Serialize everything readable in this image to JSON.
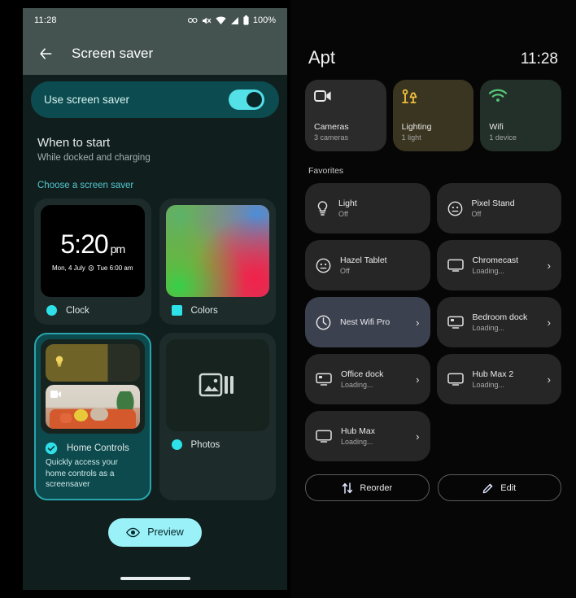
{
  "left": {
    "status_bar": {
      "time": "11:28",
      "battery": "100%",
      "icons": [
        "link-icon",
        "mute-icon",
        "wifi-icon",
        "signal-icon",
        "battery-icon"
      ]
    },
    "appbar": {
      "back_icon": "back-arrow-icon",
      "title": "Screen saver"
    },
    "toggle": {
      "label": "Use screen saver",
      "state": "on"
    },
    "when": {
      "title": "When to start",
      "subtitle": "While docked and charging"
    },
    "choose_label": "Choose a screen saver",
    "cards": [
      {
        "name": "Clock",
        "selected": false,
        "icon": "circle-dot-icon",
        "clock": {
          "time": "5:20",
          "meridiem": "pm",
          "date": "Mon, 4 July",
          "alarm": "Tue 6:00 am",
          "alarm_icon": "alarm-icon"
        }
      },
      {
        "name": "Colors",
        "selected": false,
        "icon": "square-dot-icon"
      },
      {
        "name": "Home Controls",
        "selected": true,
        "icon": "check-circle-icon",
        "description": "Quickly access your home controls as a screensaver",
        "preview_icons": [
          "bulb-icon",
          "camera-icon"
        ]
      },
      {
        "name": "Photos",
        "selected": false,
        "icon": "circle-dot-icon",
        "preview_icon": "photo-stack-icon"
      }
    ],
    "preview_button": {
      "label": "Preview",
      "icon": "eye-icon"
    }
  },
  "right": {
    "title": "Apt",
    "time": "11:28",
    "categories": [
      {
        "name": "Cameras",
        "sub": "3 cameras",
        "icon": "video-camera-icon",
        "bg": "#2b2b2b",
        "fg": "#e9e9e9"
      },
      {
        "name": "Lighting",
        "sub": "1 light",
        "icon": "lamp-icon",
        "bg": "#3a3520",
        "fg": "#f2c23e"
      },
      {
        "name": "Wifi",
        "sub": "1 device",
        "icon": "wifi-icon",
        "bg": "#23302a",
        "fg": "#57c878"
      }
    ],
    "favorites_label": "Favorites",
    "devices": [
      {
        "name": "Light",
        "status": "Off",
        "icon": "bulb-icon",
        "chevron": false,
        "highlight": false
      },
      {
        "name": "Pixel Stand",
        "status": "Off",
        "icon": "face-circle-icon",
        "chevron": false,
        "highlight": false
      },
      {
        "name": "Hazel Tablet",
        "status": "Off",
        "icon": "face-circle-icon",
        "chevron": false,
        "highlight": false
      },
      {
        "name": "Chromecast",
        "status": "Loading...",
        "icon": "tv-icon",
        "chevron": true,
        "highlight": false
      },
      {
        "name": "Nest Wifi Pro",
        "status": "",
        "icon": "nest-wifi-icon",
        "chevron": true,
        "highlight": true
      },
      {
        "name": "Bedroom dock",
        "status": "Loading...",
        "icon": "dock-icon",
        "chevron": true,
        "highlight": false
      },
      {
        "name": "Office dock",
        "status": "Loading...",
        "icon": "dock-icon",
        "chevron": true,
        "highlight": false
      },
      {
        "name": "Hub Max 2",
        "status": "Loading...",
        "icon": "tv-icon",
        "chevron": true,
        "highlight": false
      },
      {
        "name": "Hub Max",
        "status": "Loading...",
        "icon": "tv-icon",
        "chevron": true,
        "highlight": false
      }
    ],
    "buttons": [
      {
        "label": "Reorder",
        "icon": "swap-vertical-icon"
      },
      {
        "label": "Edit",
        "icon": "pencil-icon"
      }
    ]
  },
  "colors": {
    "accent_cyan": "#2ee0e8",
    "teal_dark": "#0c4b4f",
    "selected_border": "#2aa4ad",
    "preview_bg": "#9af1f7"
  }
}
